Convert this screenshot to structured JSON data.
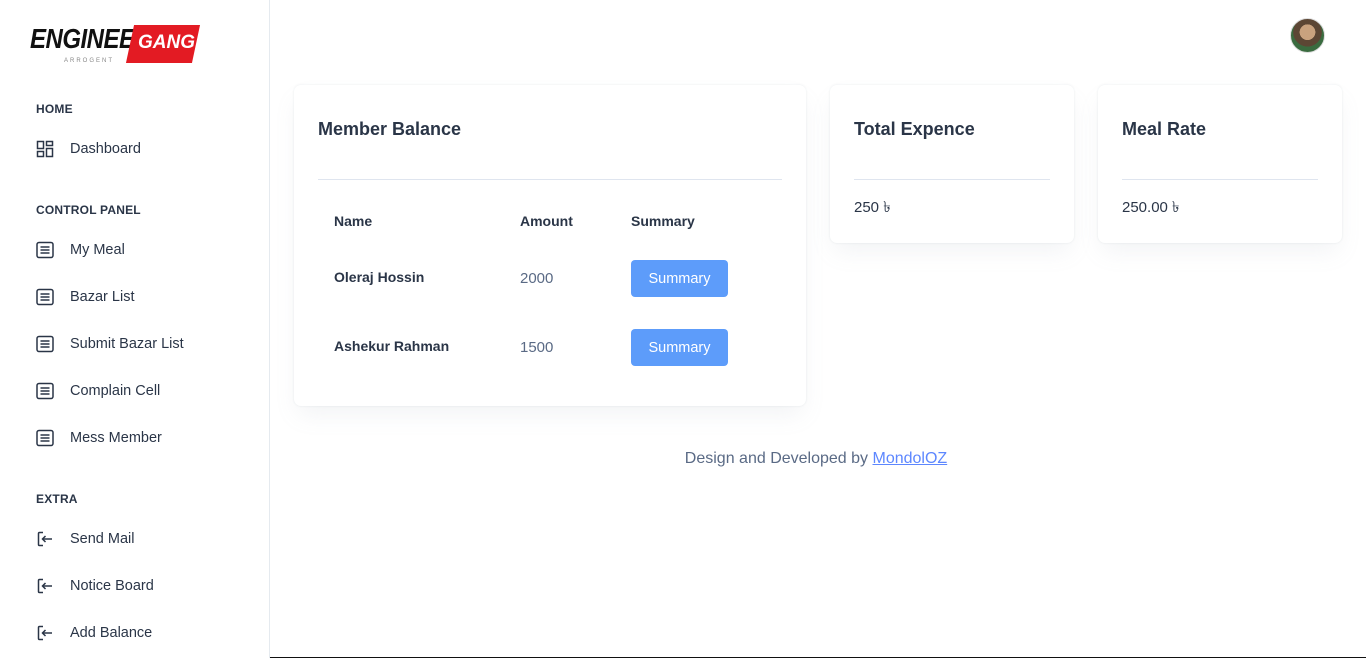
{
  "brand": {
    "word1": "ENGINEER",
    "word2": "GANG",
    "tagline": "ARROGENT"
  },
  "sidebar": {
    "sections": [
      {
        "title": "HOME",
        "items": [
          {
            "label": "Dashboard",
            "icon": "dashboard-icon"
          }
        ]
      },
      {
        "title": "CONTROL PANEL",
        "items": [
          {
            "label": "My Meal",
            "icon": "list-icon"
          },
          {
            "label": "Bazar List",
            "icon": "list-icon"
          },
          {
            "label": "Submit Bazar List",
            "icon": "list-icon"
          },
          {
            "label": "Complain Cell",
            "icon": "list-icon"
          },
          {
            "label": "Mess Member",
            "icon": "list-icon"
          }
        ]
      },
      {
        "title": "EXTRA",
        "items": [
          {
            "label": "Send Mail",
            "icon": "login-icon"
          },
          {
            "label": "Notice Board",
            "icon": "login-icon"
          },
          {
            "label": "Add Balance",
            "icon": "login-icon"
          }
        ]
      }
    ]
  },
  "member_balance": {
    "title": "Member Balance",
    "columns": [
      "Name",
      "Amount",
      "Summary"
    ],
    "rows": [
      {
        "name": "Oleraj Hossin",
        "amount": "2000",
        "action": "Summary"
      },
      {
        "name": "Ashekur Rahman",
        "amount": "1500",
        "action": "Summary"
      }
    ]
  },
  "total_expence": {
    "title": "Total Expence",
    "value": "250 ৳"
  },
  "meal_rate": {
    "title": "Meal Rate",
    "value": "250.00 ৳"
  },
  "footer": {
    "text": "Design and Developed by ",
    "link": "MondolOZ"
  },
  "colors": {
    "accent": "#5d9cfa",
    "brand_red": "#e31b23",
    "link": "#5d87ff"
  }
}
